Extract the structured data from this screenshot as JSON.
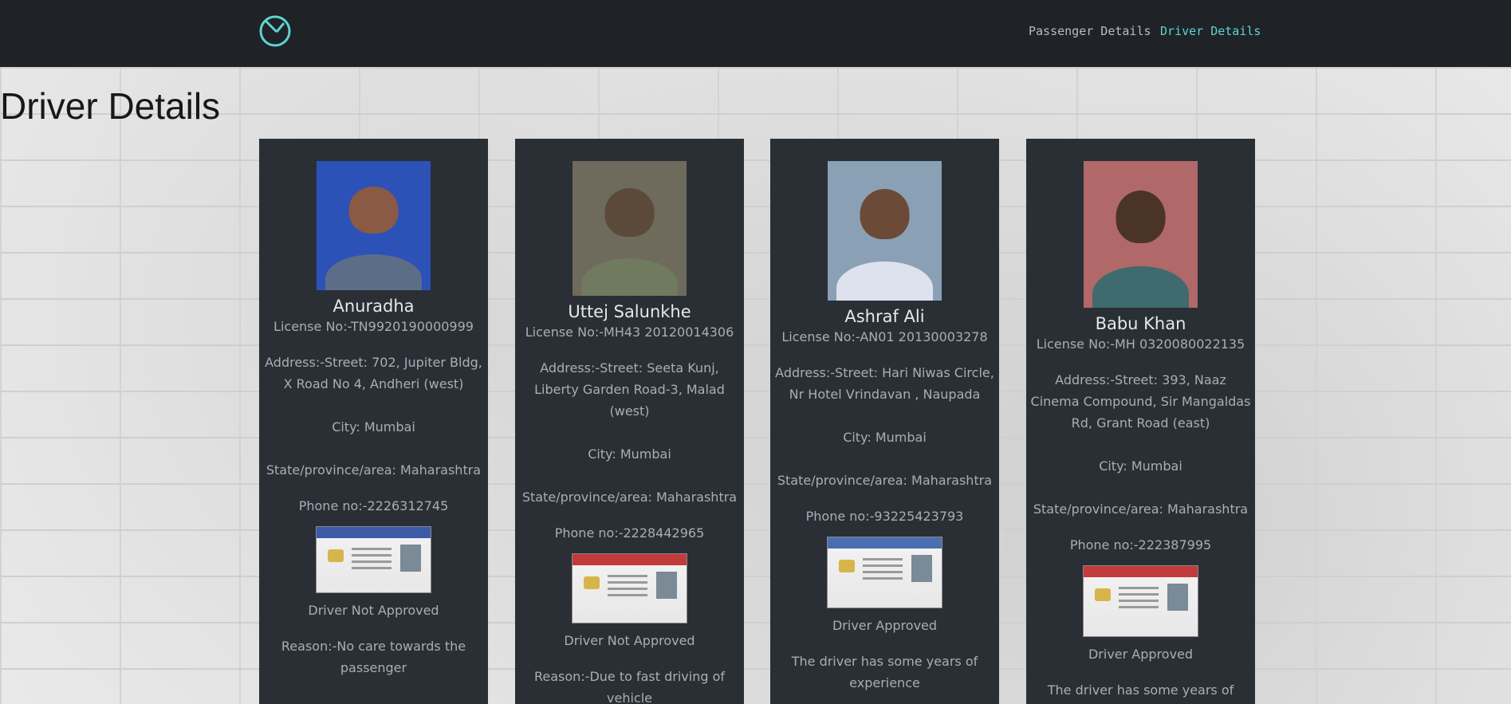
{
  "nav": {
    "passenger_label": "Passenger Details",
    "driver_label": "Driver Details"
  },
  "page_title": "Driver Details",
  "colors": {
    "nav_bg": "#1f2226",
    "card_bg": "#2a2f36",
    "accent": "#5fd3d3"
  },
  "drivers": [
    {
      "name": "Anuradha",
      "license": "License No:-TN9920190000999",
      "address": "Address:-Street: 702, Jupiter Bldg, X Road No 4, Andheri (west)",
      "city": "City: Mumbai",
      "state": "State/province/area: Maharashtra",
      "phone": "Phone no:-2226312745",
      "status": "Driver Not Approved",
      "reason": "Reason:-No care towards the passenger"
    },
    {
      "name": "Uttej Salunkhe",
      "license": "License No:-MH43 20120014306",
      "address": "Address:-Street: Seeta Kunj, Liberty Garden Road-3, Malad (west)",
      "city": "City: Mumbai",
      "state": "State/province/area: Maharashtra",
      "phone": "Phone no:-2228442965",
      "status": "Driver Not Approved",
      "reason": "Reason:-Due to fast driving of vehicle"
    },
    {
      "name": "Ashraf Ali",
      "license": "License No:-AN01 20130003278",
      "address": "Address:-Street: Hari Niwas Circle, Nr Hotel Vrindavan , Naupada",
      "city": "City: Mumbai",
      "state": "State/province/area: Maharashtra",
      "phone": "Phone no:-93225423793",
      "status": "Driver Approved",
      "reason": "The driver has some years of experience"
    },
    {
      "name": "Babu Khan",
      "license": "License No:-MH 0320080022135",
      "address": "Address:-Street: 393, Naaz Cinema Compound, Sir Mangaldas Rd, Grant Road (east)",
      "city": "City: Mumbai",
      "state": "State/province/area: Maharashtra",
      "phone": "Phone no:-222387995",
      "status": "Driver Approved",
      "reason": "The driver has some years of"
    }
  ]
}
